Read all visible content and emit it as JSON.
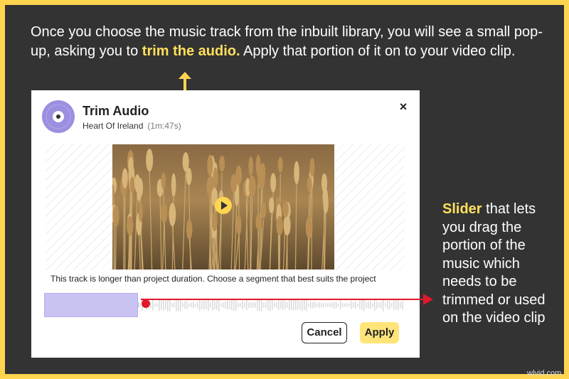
{
  "intro": {
    "part1": "Once you choose the music track from the inbuilt library, you will see a small pop-up, asking you to ",
    "highlight": "trim the audio.",
    "part2": " Apply that portion of it on to your video clip."
  },
  "dialog": {
    "title": "Trim Audio",
    "track_name": "Heart Of Ireland",
    "track_duration": "(1m:47s)",
    "close_label": "×",
    "caption": "This track is longer than project duration. Choose a segment that best suits the project",
    "cancel_label": "Cancel",
    "apply_label": "Apply",
    "selection_fraction": 0.26
  },
  "annotation": {
    "highlight": "Slider",
    "text": " that lets you drag the portion of the music which needs to be trimmed or used on the video clip"
  },
  "watermark": "wlvid.com",
  "colors": {
    "frame": "#ffd54f",
    "background": "#333333",
    "highlight": "#ffe05c",
    "avatar": "#9b8fe0",
    "selection": "#c9c3f2",
    "slider_line": "#e0182c",
    "apply_button": "#ffe47a"
  },
  "icons": {
    "avatar": "music-disc-icon",
    "close": "close-icon",
    "play": "play-icon"
  }
}
